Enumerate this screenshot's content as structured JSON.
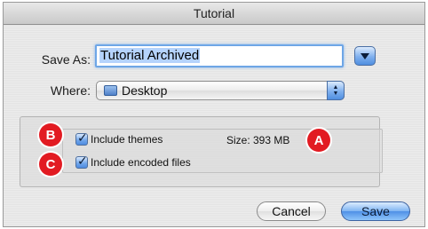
{
  "window": {
    "title": "Tutorial"
  },
  "save_as": {
    "label": "Save As:",
    "value": "Tutorial Archived"
  },
  "where": {
    "label": "Where:",
    "value": "Desktop"
  },
  "options": {
    "include_themes": {
      "label": "Include themes",
      "checked": true
    },
    "include_encoded": {
      "label": "Include encoded files",
      "checked": true
    },
    "size_text": "Size: 393 MB"
  },
  "badges": {
    "a": "A",
    "b": "B",
    "c": "C"
  },
  "buttons": {
    "cancel": "Cancel",
    "save": "Save"
  },
  "colors": {
    "badge": "#e21b22",
    "accent": "#4f90e6"
  }
}
